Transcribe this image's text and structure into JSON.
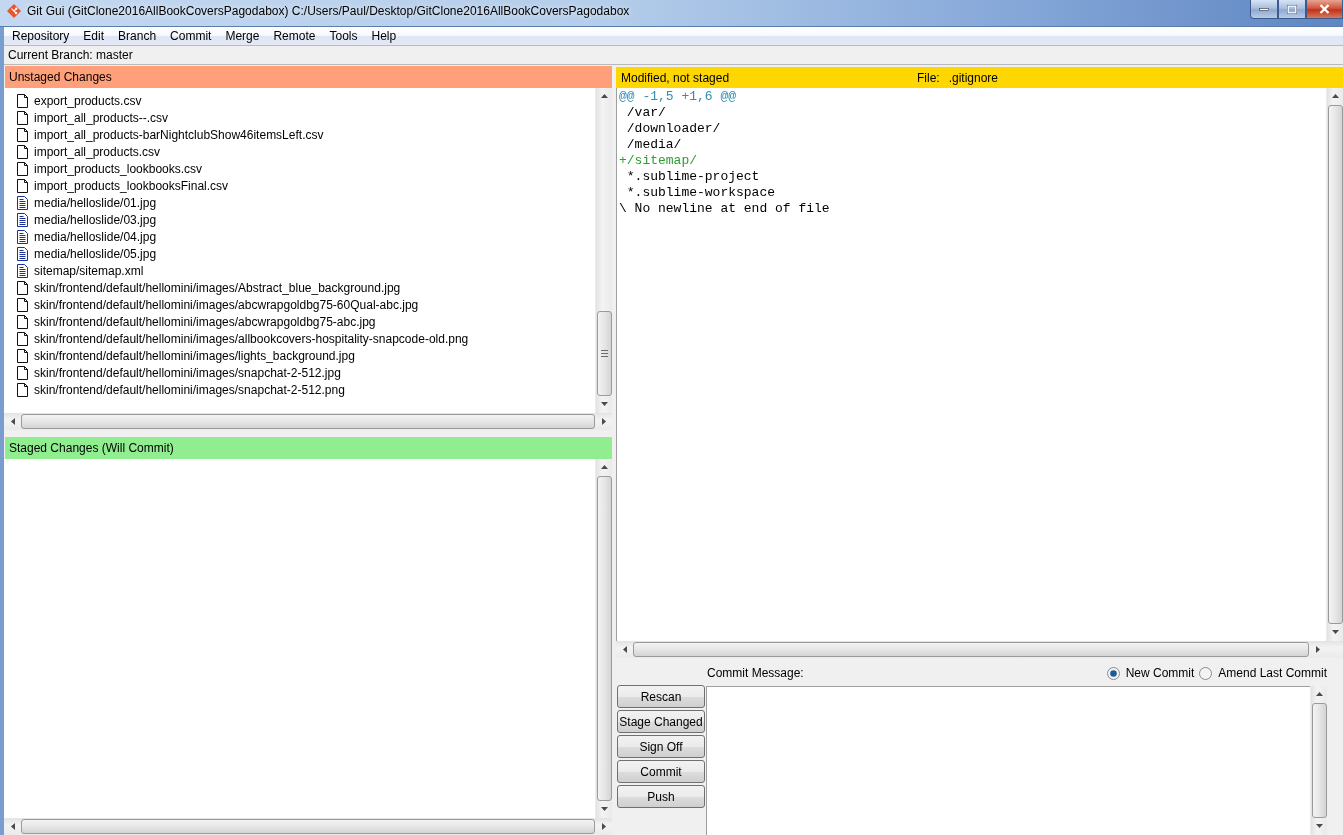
{
  "window": {
    "title": "Git Gui (GitClone2016AllBookCoversPagodabox) C:/Users/Paul/Desktop/GitClone2016AllBookCoversPagodabox"
  },
  "menu_bar": [
    "Repository",
    "Edit",
    "Branch",
    "Commit",
    "Merge",
    "Remote",
    "Tools",
    "Help"
  ],
  "current_branch": "Current Branch: master",
  "unstaged": {
    "title": "Unstaged Changes",
    "files": [
      {
        "path": "export_products.csv",
        "kind": "untracked"
      },
      {
        "path": "import_all_products--.csv",
        "kind": "untracked"
      },
      {
        "path": "import_all_products-barNightclubShow46itemsLeft.csv",
        "kind": "untracked"
      },
      {
        "path": "import_all_products.csv",
        "kind": "untracked"
      },
      {
        "path": "import_products_lookbooks.csv",
        "kind": "untracked"
      },
      {
        "path": "import_products_lookbooksFinal.csv",
        "kind": "untracked"
      },
      {
        "path": "media/helloslide/01.jpg",
        "kind": "modified"
      },
      {
        "path": "media/helloslide/03.jpg",
        "kind": "modified"
      },
      {
        "path": "media/helloslide/04.jpg",
        "kind": "modified"
      },
      {
        "path": "media/helloslide/05.jpg",
        "kind": "modified"
      },
      {
        "path": "sitemap/sitemap.xml",
        "kind": "modified"
      },
      {
        "path": "skin/frontend/default/hellomini/images/Abstract_blue_background.jpg",
        "kind": "untracked"
      },
      {
        "path": "skin/frontend/default/hellomini/images/abcwrapgoldbg75-60Qual-abc.jpg",
        "kind": "untracked"
      },
      {
        "path": "skin/frontend/default/hellomini/images/abcwrapgoldbg75-abc.jpg",
        "kind": "untracked"
      },
      {
        "path": "skin/frontend/default/hellomini/images/allbookcovers-hospitality-snapcode-old.png",
        "kind": "untracked"
      },
      {
        "path": "skin/frontend/default/hellomini/images/lights_background.jpg",
        "kind": "untracked"
      },
      {
        "path": "skin/frontend/default/hellomini/images/snapchat-2-512.jpg",
        "kind": "untracked"
      },
      {
        "path": "skin/frontend/default/hellomini/images/snapchat-2-512.png",
        "kind": "untracked"
      }
    ]
  },
  "staged": {
    "title": "Staged Changes (Will Commit)"
  },
  "diff": {
    "status": "Modified, not staged",
    "file_label": "File:",
    "file_name": ".gitignore",
    "lines": [
      {
        "kind": "hunk",
        "text": "@@ -1,5 +1,6 @@"
      },
      {
        "kind": "context",
        "text": " /var/"
      },
      {
        "kind": "context",
        "text": " /downloader/"
      },
      {
        "kind": "context",
        "text": " /media/"
      },
      {
        "kind": "added",
        "text": "+/sitemap/"
      },
      {
        "kind": "context",
        "text": " *.sublime-project"
      },
      {
        "kind": "context",
        "text": " *.sublime-workspace"
      },
      {
        "kind": "note",
        "text": "\\ No newline at end of file"
      }
    ]
  },
  "commit": {
    "message_label": "Commit Message:",
    "modes": [
      {
        "label": "New Commit",
        "selected": true
      },
      {
        "label": "Amend Last Commit",
        "selected": false
      }
    ],
    "buttons": [
      "Rescan",
      "Stage Changed",
      "Sign Off",
      "Commit",
      "Push"
    ]
  }
}
